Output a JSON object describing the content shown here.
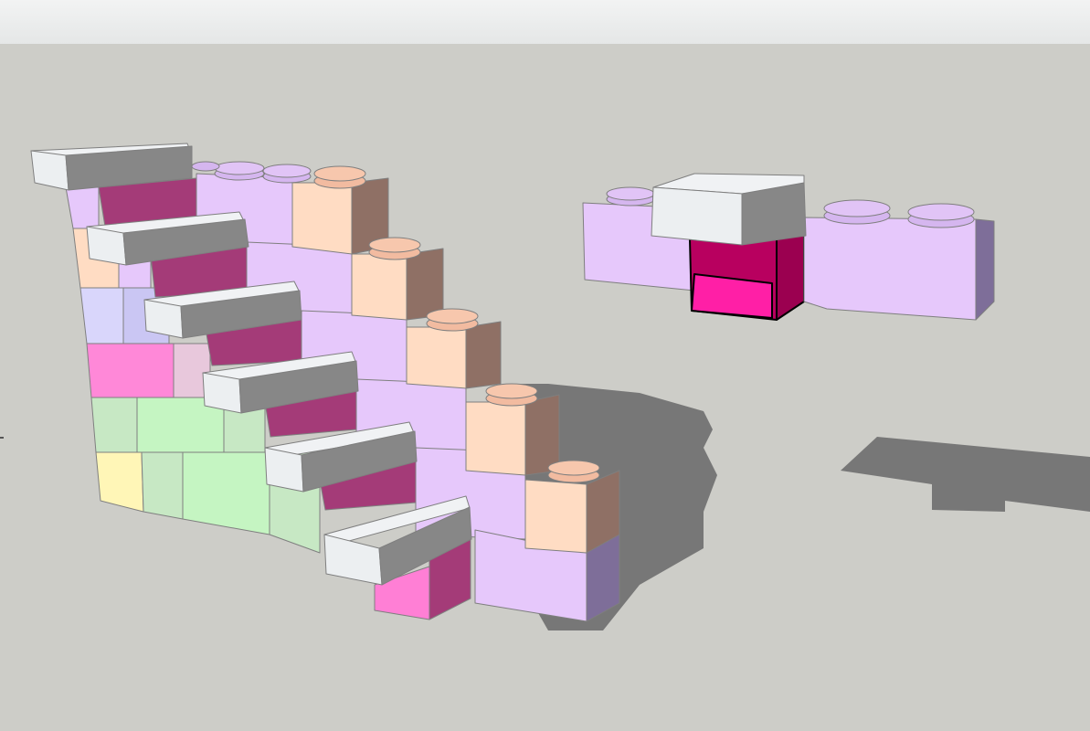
{
  "app": {
    "toolbar_title": ""
  },
  "colors": {
    "background": "#cdcdc8",
    "shadow": "#777777",
    "lavender": "#e6c8fb",
    "peach": "#ffdcc3",
    "peach_stud": "#f2bba0",
    "lavender_stud": "#d5b6ef",
    "white_block": "#eceff1",
    "magenta_highlight": "#ff1fa6",
    "green": "#c5f5c2",
    "pink": "#ff88d8",
    "periwinkle": "#d9d6fb",
    "yellow": "#fff6b7"
  }
}
